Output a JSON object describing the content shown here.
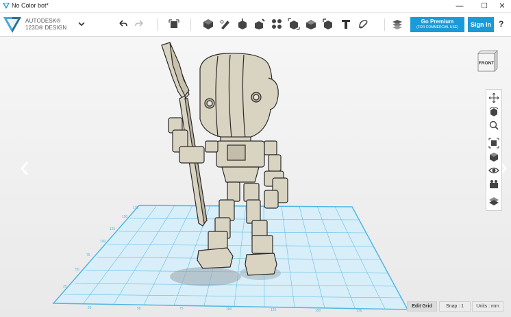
{
  "window": {
    "title": "No Color bot*",
    "minimize": "—",
    "maximize": "☐",
    "close": "✕"
  },
  "brand": {
    "line1": "AUTODESK®",
    "line2": "123D® DESIGN"
  },
  "toolbar": {
    "icons": [
      "undo-icon",
      "redo-icon",
      "smart-scale-icon",
      "primitives-icon",
      "sketch-icon",
      "construct-icon",
      "modify-icon",
      "pattern-icon",
      "group-icon",
      "combine-icon",
      "measure-icon",
      "text-icon",
      "snap-icon",
      "material-icon"
    ],
    "premium_title": "Go Premium",
    "premium_sub": "(FOR COMMERCIAL USE)",
    "signin": "Sign In",
    "help": "?"
  },
  "viewcube": {
    "face": "FRONT"
  },
  "navbar": {
    "items": [
      "pan-icon",
      "orbit-icon",
      "zoom-icon",
      "fit-icon",
      "views-icon",
      "visibility-icon",
      "material-view-icon",
      "grid-icon"
    ]
  },
  "grid": {
    "x_ticks": [
      "25",
      "50",
      "75",
      "100",
      "125",
      "150",
      "175"
    ],
    "y_ticks": [
      "25",
      "50",
      "75",
      "100",
      "125",
      "150",
      "175"
    ]
  },
  "status": {
    "edit_grid": "Edit Grid",
    "snap": "Snap : 1",
    "units": "Units : mm"
  },
  "colors": {
    "accent": "#1a9ad6",
    "grid": "#4fb6e3",
    "grid_fill": "#cfe9f6",
    "model": "#d9d3c2"
  }
}
